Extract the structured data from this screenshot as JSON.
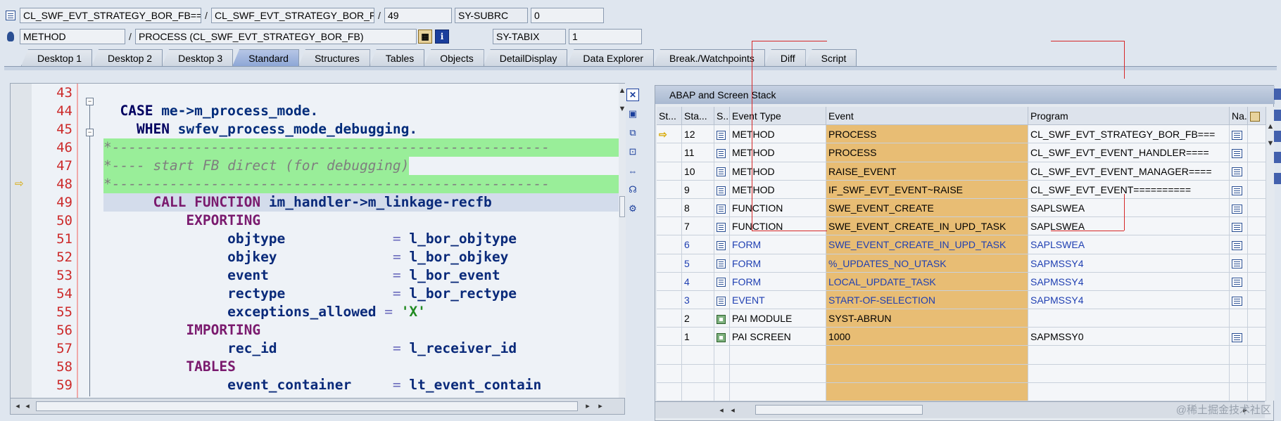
{
  "header": {
    "row1": {
      "program": "CL_SWF_EVT_STRATEGY_BOR_FB===",
      "include": "CL_SWF_EVT_STRATEGY_BOR_FB===",
      "line": "49",
      "sysfield_label": "SY-SUBRC",
      "sysfield_value": "0"
    },
    "row2": {
      "type": "METHOD",
      "name": "PROCESS (CL_SWF_EVT_STRATEGY_BOR_FB)",
      "sysfield_label": "SY-TABIX",
      "sysfield_value": "1"
    },
    "separator": "/"
  },
  "tabs": [
    "Desktop 1",
    "Desktop 2",
    "Desktop 3",
    "Standard",
    "Structures",
    "Tables",
    "Objects",
    "DetailDisplay",
    "Data Explorer",
    "Break./Watchpoints",
    "Diff",
    "Script"
  ],
  "active_tab": "Standard",
  "source": {
    "line_numbers": [
      "43",
      "44",
      "45",
      "46",
      "47",
      "48",
      "49",
      "50",
      "51",
      "52",
      "53",
      "54",
      "55",
      "56",
      "57",
      "58",
      "59"
    ],
    "lines": {
      "l44_kw": "CASE",
      "l44_rest": " me->m_process_mode.",
      "l45_kw": "WHEN",
      "l45_rest": " swfev_process_mode_debugging.",
      "l46": "*-----------------------------------------------------",
      "l47": "*---- start FB direct (for debugging)",
      "l48": "*-----------------------------------------------------",
      "l49_kw": "CALL FUNCTION",
      "l49_rest": " im_handler->m_linkage-recfb",
      "l50": "EXPORTING",
      "l51_p": "objtype",
      "l51_v": "l_bor_objtype",
      "l52_p": "objkey",
      "l52_v": "l_bor_objkey",
      "l53_p": "event",
      "l53_v": "l_bor_event",
      "l54_p": "rectype",
      "l54_v": "l_bor_rectype",
      "l55_p": "exceptions_allowed",
      "l55_v": "'X'",
      "l56": "IMPORTING",
      "l57_p": "rec_id",
      "l57_v": "l_receiver_id",
      "l58": "TABLES",
      "l59_p": "event_container",
      "l59_v": "lt_event_contain",
      "eq": "="
    }
  },
  "stack": {
    "title": "ABAP and Screen Stack",
    "columns": [
      "St...",
      "Sta...",
      "S..",
      "Event Type",
      "Event",
      "Program",
      "Na."
    ],
    "rows": [
      {
        "step": "12",
        "type": "METHOD",
        "event": "PROCESS",
        "program": "CL_SWF_EVT_STRATEGY_BOR_FB===",
        "current": true,
        "blue": false,
        "nav": true
      },
      {
        "step": "11",
        "type": "METHOD",
        "event": "PROCESS",
        "program": "CL_SWF_EVT_EVENT_HANDLER====",
        "current": false,
        "blue": false,
        "nav": true
      },
      {
        "step": "10",
        "type": "METHOD",
        "event": "RAISE_EVENT",
        "program": "CL_SWF_EVT_EVENT_MANAGER====",
        "current": false,
        "blue": false,
        "nav": true
      },
      {
        "step": "9",
        "type": "METHOD",
        "event": "IF_SWF_EVT_EVENT~RAISE",
        "program": "CL_SWF_EVT_EVENT==========",
        "current": false,
        "blue": false,
        "nav": true
      },
      {
        "step": "8",
        "type": "FUNCTION",
        "event": "SWE_EVENT_CREATE",
        "program": "SAPLSWEA",
        "current": false,
        "blue": false,
        "nav": true
      },
      {
        "step": "7",
        "type": "FUNCTION",
        "event": "SWE_EVENT_CREATE_IN_UPD_TASK",
        "program": "SAPLSWEA",
        "current": false,
        "blue": false,
        "nav": true
      },
      {
        "step": "6",
        "type": "FORM",
        "event": "SWE_EVENT_CREATE_IN_UPD_TASK",
        "program": "SAPLSWEA",
        "current": false,
        "blue": true,
        "nav": true
      },
      {
        "step": "5",
        "type": "FORM",
        "event": "%_UPDATES_NO_UTASK",
        "program": "SAPMSSY4",
        "current": false,
        "blue": true,
        "nav": true
      },
      {
        "step": "4",
        "type": "FORM",
        "event": "LOCAL_UPDATE_TASK",
        "program": "SAPMSSY4",
        "current": false,
        "blue": true,
        "nav": true
      },
      {
        "step": "3",
        "type": "EVENT",
        "event": "START-OF-SELECTION",
        "program": "SAPMSSY4",
        "current": false,
        "blue": true,
        "nav": true
      },
      {
        "step": "2",
        "type": "PAI MODULE",
        "event": "SYST-ABRUN",
        "program": "",
        "current": false,
        "blue": false,
        "nav": false,
        "screen": true
      },
      {
        "step": "1",
        "type": "PAI SCREEN",
        "event": "1000",
        "program": "SAPMSSY0",
        "current": false,
        "blue": false,
        "nav": true,
        "screen": true
      }
    ]
  },
  "watermark": "@稀土掘金技术社区",
  "icons": {
    "current_line": "yellow-arrow-icon",
    "close": "close-icon"
  }
}
